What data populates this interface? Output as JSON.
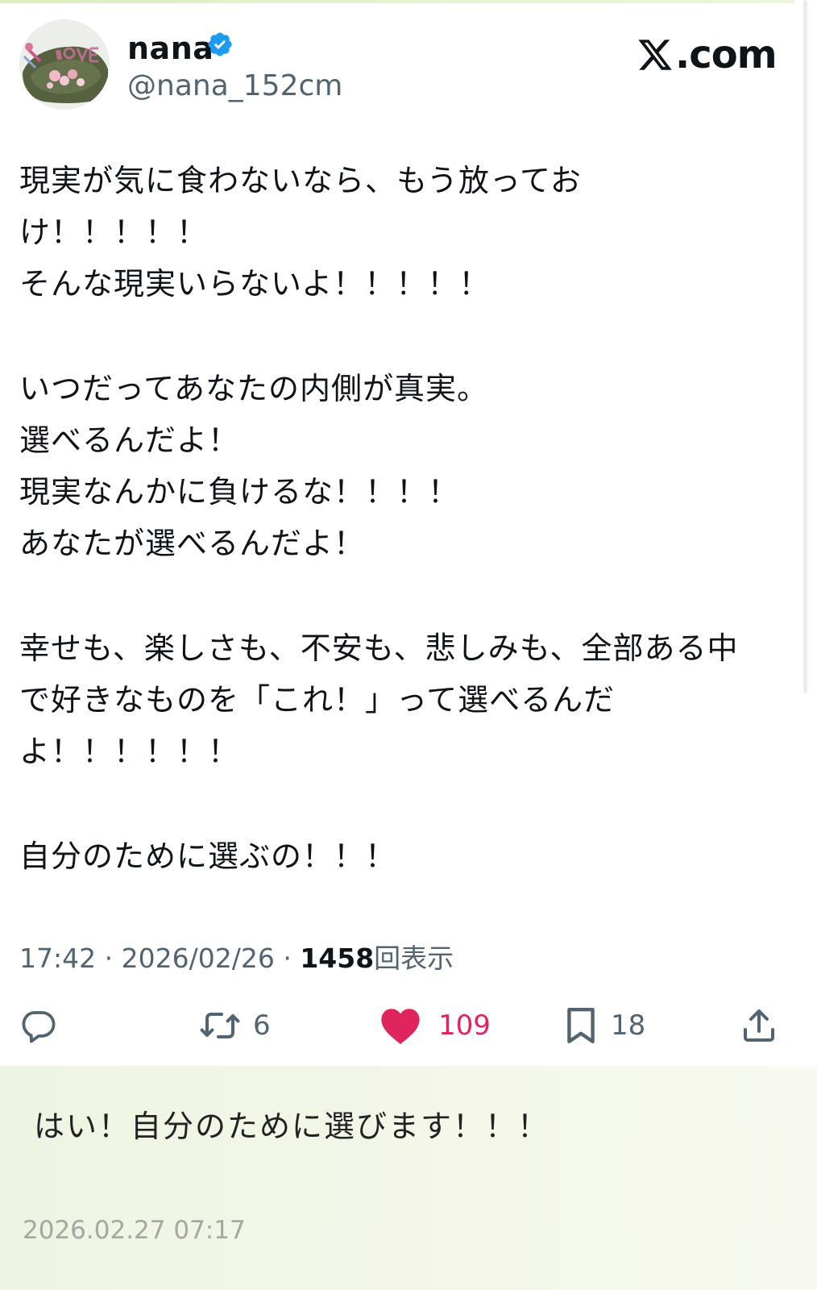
{
  "tweet": {
    "author_name": "nana",
    "handle": "@nana_152cm",
    "brand": "com",
    "lines": [
      "現実が気に食わないなら、もう放ってお",
      "け！！！！！",
      "そんな現実いらないよ！！！！！",
      "",
      "いつだってあなたの内側が真実。",
      "選べるんだよ！",
      "現実なんかに負けるな！！！！",
      "あなたが選べるんだよ！",
      "",
      "幸せも、楽しさも、不安も、悲しみも、全部ある中",
      "で好きなものを「これ！」って選べるんだ",
      "よ！！！！！！",
      "",
      "自分のために選ぶの！！！"
    ],
    "time": "17:42",
    "date": "2026/02/26",
    "views_count": "1458",
    "views_label": "回表示",
    "separator": "·",
    "retweets": "6",
    "likes": "109",
    "bookmarks": "18"
  },
  "colors": {
    "verified": "#1d9bf0",
    "like": "#e0245e",
    "icon": "#536471"
  },
  "icons": [
    "verified-badge-icon",
    "x-logo-icon",
    "reply-icon",
    "retweet-icon",
    "heart-icon",
    "bookmark-icon",
    "share-icon"
  ],
  "comment": {
    "text": "はい！自分のために選びます！！！",
    "timestamp": "2026.02.27 07:17"
  }
}
